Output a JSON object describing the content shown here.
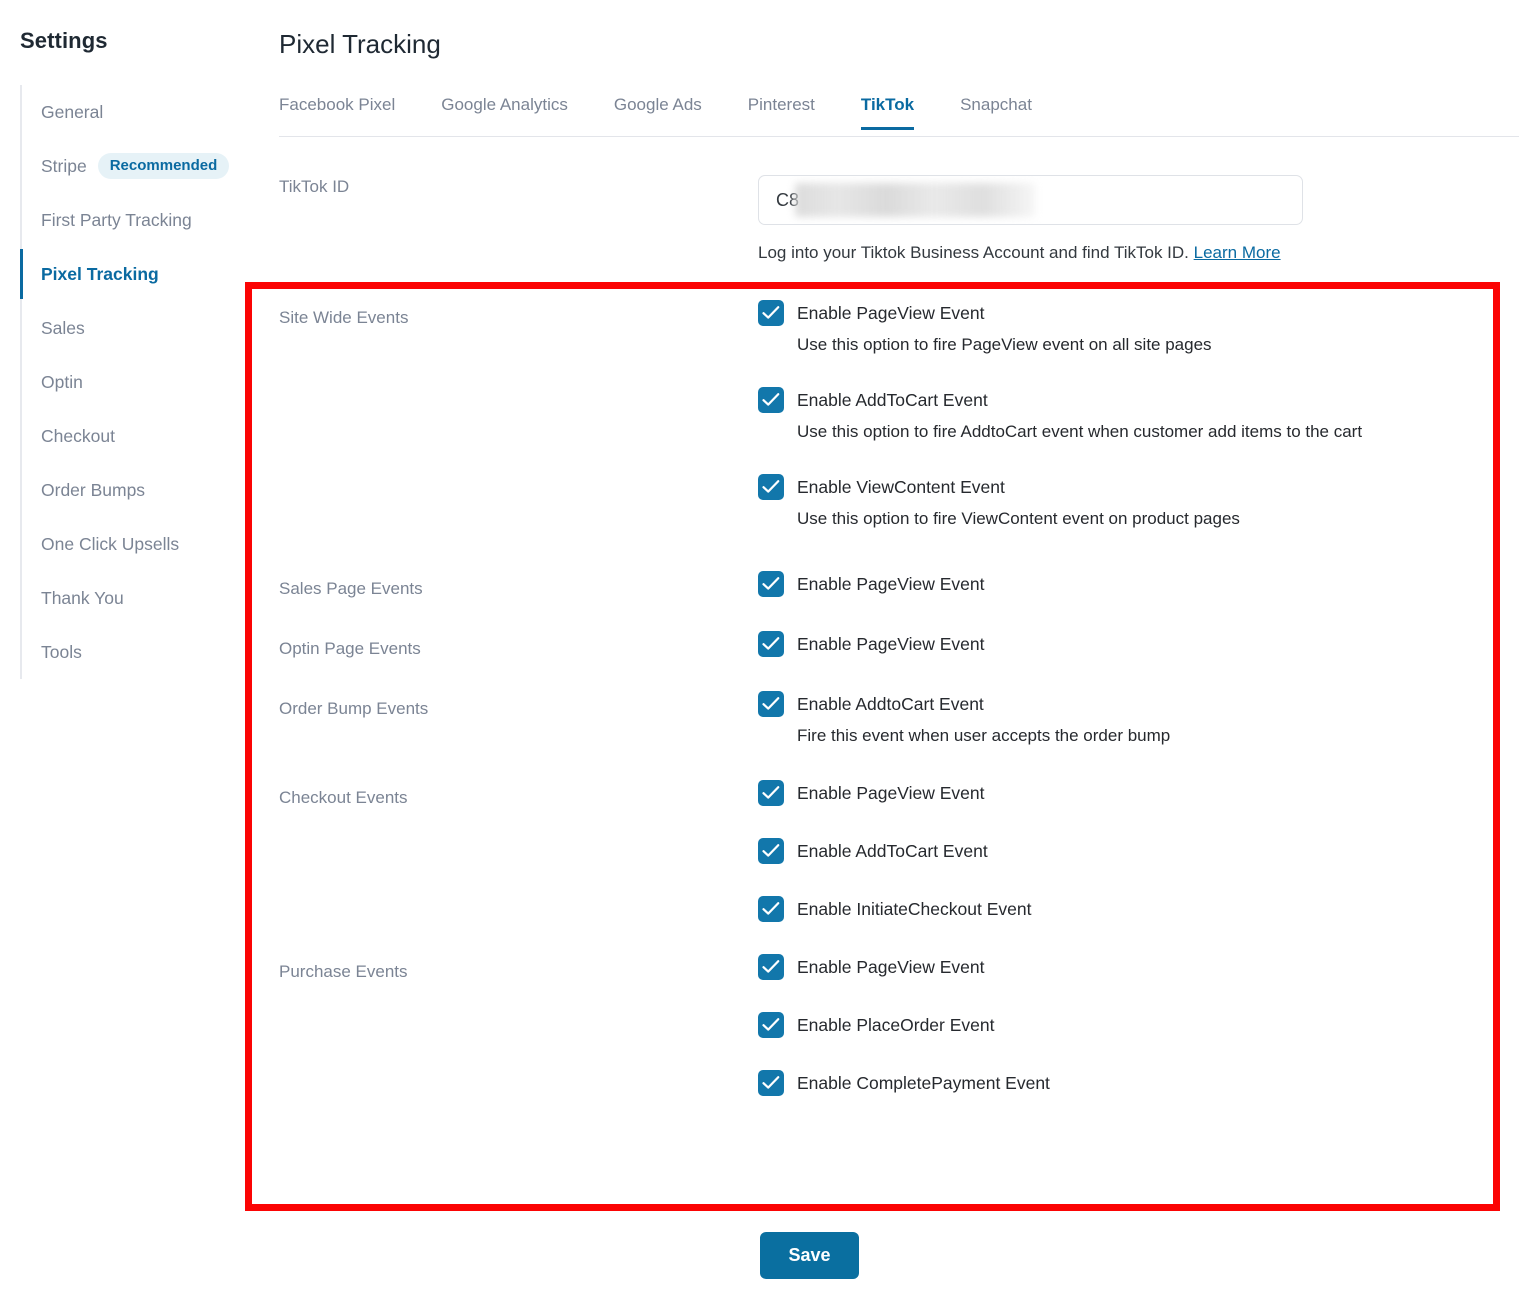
{
  "sidebar": {
    "title": "Settings",
    "items": [
      {
        "label": "General",
        "active": false,
        "badge": null
      },
      {
        "label": "Stripe",
        "active": false,
        "badge": "Recommended"
      },
      {
        "label": "First Party Tracking",
        "active": false,
        "badge": null
      },
      {
        "label": "Pixel Tracking",
        "active": true,
        "badge": null
      },
      {
        "label": "Sales",
        "active": false,
        "badge": null
      },
      {
        "label": "Optin",
        "active": false,
        "badge": null
      },
      {
        "label": "Checkout",
        "active": false,
        "badge": null
      },
      {
        "label": "Order Bumps",
        "active": false,
        "badge": null
      },
      {
        "label": "One Click Upsells",
        "active": false,
        "badge": null
      },
      {
        "label": "Thank You",
        "active": false,
        "badge": null
      },
      {
        "label": "Tools",
        "active": false,
        "badge": null
      }
    ]
  },
  "main": {
    "page_title": "Pixel Tracking",
    "tabs": [
      {
        "label": "Facebook Pixel",
        "active": false
      },
      {
        "label": "Google Analytics",
        "active": false
      },
      {
        "label": "Google Ads",
        "active": false
      },
      {
        "label": "Pinterest",
        "active": false
      },
      {
        "label": "TikTok",
        "active": true
      },
      {
        "label": "Snapchat",
        "active": false
      }
    ],
    "tiktok_id": {
      "label": "TikTok ID",
      "value": "C8",
      "redacted": true,
      "help_text": "Log into your Tiktok Business Account and find TikTok ID.",
      "help_link_text": "Learn More"
    },
    "event_groups": [
      {
        "label": "Site Wide Events",
        "rows": [
          {
            "checked": true,
            "label": "Enable PageView Event",
            "desc": "Use this option to fire PageView event on all site pages"
          },
          {
            "checked": true,
            "label": "Enable AddToCart Event",
            "desc": "Use this option to fire AddtoCart event when customer add items to the cart"
          },
          {
            "checked": true,
            "label": "Enable ViewContent Event",
            "desc": "Use this option to fire ViewContent event on product pages"
          }
        ]
      },
      {
        "label": "Sales Page Events",
        "rows": [
          {
            "checked": true,
            "label": "Enable PageView Event",
            "desc": null
          }
        ]
      },
      {
        "label": "Optin Page Events",
        "rows": [
          {
            "checked": true,
            "label": "Enable PageView Event",
            "desc": null
          }
        ]
      },
      {
        "label": "Order Bump Events",
        "rows": [
          {
            "checked": true,
            "label": "Enable AddtoCart Event",
            "desc": "Fire this event when user accepts the order bump"
          }
        ]
      },
      {
        "label": "Checkout Events",
        "rows": [
          {
            "checked": true,
            "label": "Enable PageView Event",
            "desc": null
          },
          {
            "checked": true,
            "label": "Enable AddToCart Event",
            "desc": null
          },
          {
            "checked": true,
            "label": "Enable InitiateCheckout Event",
            "desc": null
          }
        ]
      },
      {
        "label": "Purchase Events",
        "rows": [
          {
            "checked": true,
            "label": "Enable PageView Event",
            "desc": null
          },
          {
            "checked": true,
            "label": "Enable PlaceOrder Event",
            "desc": null
          },
          {
            "checked": true,
            "label": "Enable CompletePayment Event",
            "desc": null
          }
        ]
      }
    ],
    "save_label": "Save",
    "highlight_color": "#fb0404"
  },
  "colors": {
    "accent": "#0a6aa1",
    "checkbox": "#1277ab",
    "muted_text": "#7b8494",
    "body_text": "#26292e",
    "badge_bg": "#e6f2f7",
    "save_bg": "#0a6fa0"
  }
}
